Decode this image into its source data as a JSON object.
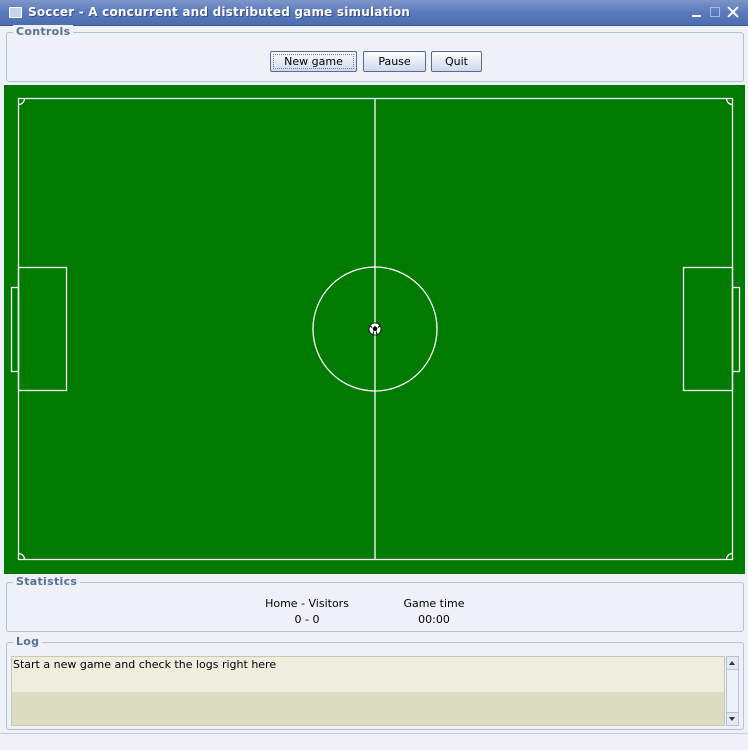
{
  "window": {
    "title": "Soccer - A concurrent and distributed game simulation"
  },
  "controls": {
    "legend": "Controls",
    "new_game_label": "New game",
    "pause_label": "Pause",
    "quit_label": "Quit"
  },
  "field": {
    "pitch_color": "#007a00",
    "line_color": "#ffffff",
    "ball_icon": "soccer-ball-icon"
  },
  "statistics": {
    "legend": "Statistics",
    "score_label": "Home - Visitors",
    "score_value": "0 - 0",
    "time_label": "Game time",
    "time_value": "00:00"
  },
  "log": {
    "legend": "Log",
    "lines": [
      "Start a new game and check the logs right here",
      ""
    ]
  },
  "colors": {
    "titlebar": "#5d7cbf",
    "background": "#eef1f8",
    "legend_text": "#5b6f95",
    "log_row_1": "#eeeedf",
    "log_row_2": "#dcdcc2"
  }
}
